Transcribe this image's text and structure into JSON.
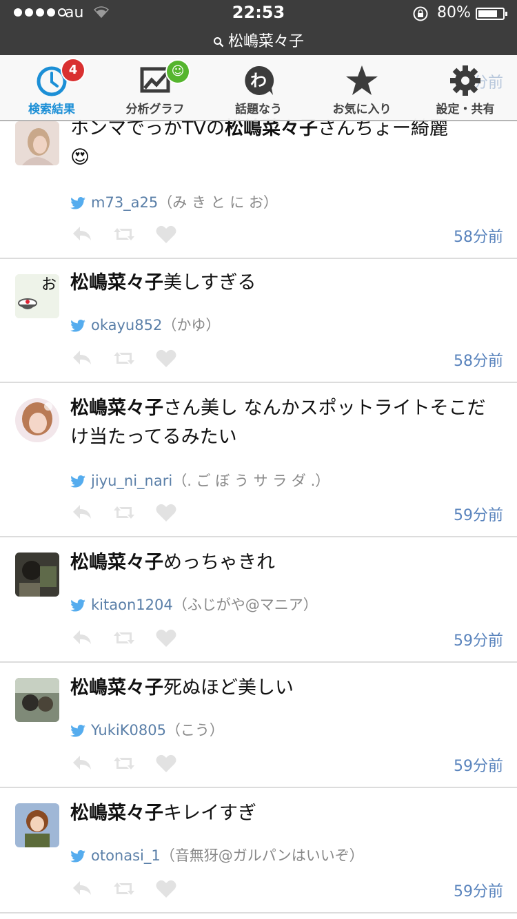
{
  "status_bar": {
    "carrier": "au",
    "time": "22:53",
    "battery_percent": "80%",
    "battery_level": 0.8,
    "signal_bars_filled": 4,
    "signal_bars_total": 5,
    "search_query": "松嶋菜々子"
  },
  "tabs": [
    {
      "label": "検索結果",
      "icon": "clock-icon",
      "badge": "4",
      "badge_color": "#d93030",
      "active": true
    },
    {
      "label": "分析グラフ",
      "icon": "chart-icon",
      "badge": "☺",
      "badge_color": "#55b52e",
      "active": false
    },
    {
      "label": "話題なう",
      "icon": "wa-bubble-icon",
      "active": false
    },
    {
      "label": "お気に入り",
      "icon": "star-icon",
      "active": false
    },
    {
      "label": "設定・共有",
      "icon": "gear-icon",
      "active": false
    }
  ],
  "behind_tabbar_time": "分前",
  "colors": {
    "accent": "#1c8fd6",
    "link": "#5a7fa8",
    "time": "#5a84bd",
    "status_bar": "#3d3d3d",
    "twitter_bird": "#55acee"
  },
  "tweets": [
    {
      "text_keyword": "",
      "text_pre": "ホンマでっかTVの",
      "text_keyword2": "松嶋菜々子",
      "text_rest": "さんちょー綺麗",
      "emoji": "😍",
      "username": "m73_a25",
      "display_name": "（み き と に お）",
      "time_ago": "58分前"
    },
    {
      "text_keyword": "松嶋菜々子",
      "text_rest": "美しすぎる",
      "username": "okayu852",
      "display_name": "（かゆ）",
      "avatar_char": "お",
      "time_ago": "58分前"
    },
    {
      "text_keyword": "松嶋菜々子",
      "text_rest": "さん美し なんかスポットライトそこだけ当たってるみたい",
      "username": "jiyu_ni_nari",
      "display_name": "（. ご ぼ う サ ラ ダ .）",
      "time_ago": "59分前"
    },
    {
      "text_keyword": "松嶋菜々子",
      "text_rest": "めっちゃきれ",
      "username": "kitaon1204",
      "display_name": "（ふじがや@マニア）",
      "time_ago": "59分前"
    },
    {
      "text_keyword": "松嶋菜々子",
      "text_rest": "死ぬほど美しい",
      "username": "YukiK0805",
      "display_name": "（こう）",
      "time_ago": "59分前"
    },
    {
      "text_keyword": "松嶋菜々子",
      "text_rest": "キレイすぎ",
      "username": "otonasi_1",
      "display_name": "（音無犽@ガルパンはいいぞ）",
      "time_ago": "59分前"
    }
  ]
}
